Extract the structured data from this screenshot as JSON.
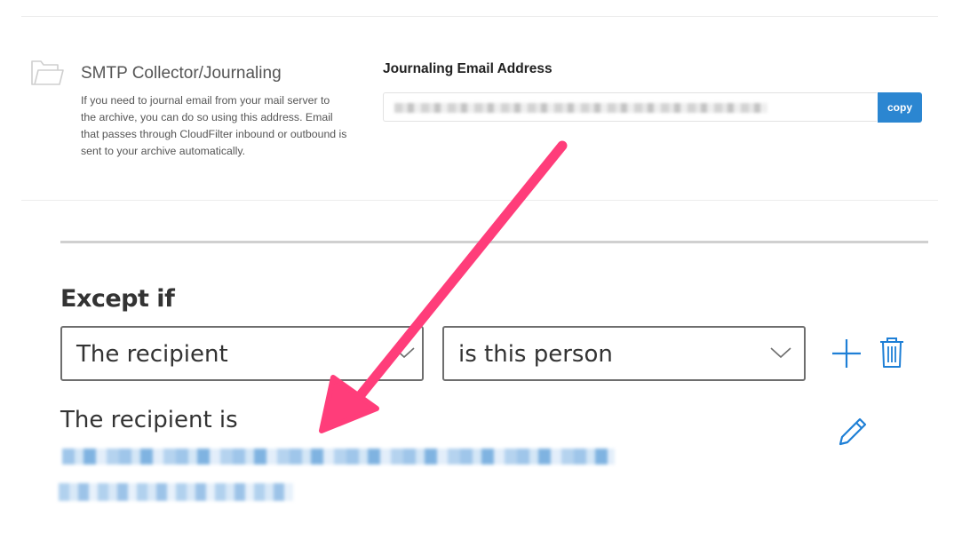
{
  "smtp": {
    "title": "SMTP Collector/Journaling",
    "description": "If you need to journal email from your mail server to the archive, you can do so using this address. Email that passes through CloudFilter inbound or outbound is sent to your archive automatically."
  },
  "journaling": {
    "label": "Journaling Email Address",
    "copy_label": "copy"
  },
  "rule": {
    "except_title": "Except if",
    "condition_field": "The recipient",
    "condition_operator": "is this person",
    "recipient_heading": "The recipient is"
  },
  "colors": {
    "accent": "#2b86d1",
    "annotation_arrow": "#ff3d7a"
  },
  "icons": [
    "folder-icon",
    "chevron-down-icon",
    "plus-icon",
    "trash-icon",
    "pencil-icon",
    "arrow-annotation"
  ]
}
